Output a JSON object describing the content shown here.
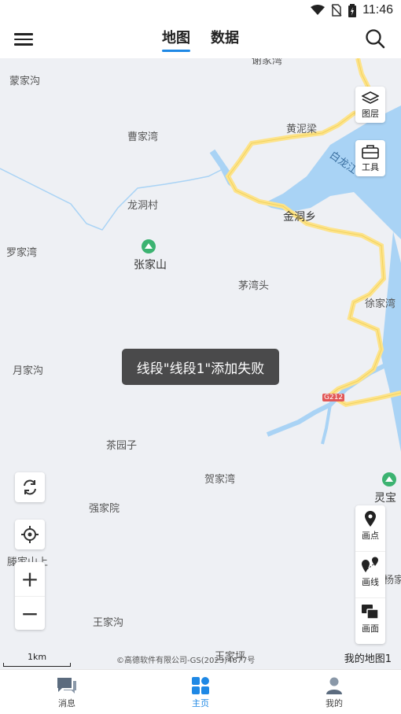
{
  "status": {
    "time": "11:46",
    "icons": [
      "wifi-icon",
      "no-sim-icon",
      "battery-icon"
    ]
  },
  "header": {
    "tabs": [
      {
        "label": "地图",
        "active": true
      },
      {
        "label": "数据",
        "active": false
      }
    ]
  },
  "map": {
    "places": {
      "mengjiagou": "蒙家沟",
      "xiejiawan": "谢家湾",
      "caojiawan": "曹家湾",
      "huangniliang": "黄泥梁",
      "bailongjiang": "白龙江",
      "longdongcun": "龙洞村",
      "jindongxiang": "金洞乡",
      "luojiawan": "罗家湾",
      "zhangjiashan": "张家山",
      "maowantou": "茅湾头",
      "xujiawan": "徐家湾",
      "yuejiagou": "月家沟",
      "road_code": "G212",
      "chayuanzi": "茶园子",
      "hejiawan": "贺家湾",
      "lingbao": "灵宝",
      "qiangjiayuan": "强家院",
      "tengjiashanshang": "滕家山上",
      "yangjia": "杨家",
      "wangjiagou": "王家沟",
      "wangjiaping": "王家坪"
    },
    "tools": {
      "layers": "图层",
      "tools": "工具"
    },
    "draw": {
      "point": "画点",
      "line": "画线",
      "area": "画面"
    },
    "zoom": {
      "in": "+",
      "out": "−"
    },
    "toast": "线段\"线段1\"添加失败",
    "scale": "1km",
    "copyright": "©高德软件有限公司-GS(2023)4677号",
    "map_name": "我的地图1",
    "colors": {
      "water": "#a9d3f5",
      "road": "#fde38a",
      "road_edge": "#f2d35e",
      "accent": "#1e88e5"
    }
  },
  "nav": {
    "messages": "消息",
    "home": "主页",
    "mine": "我的"
  }
}
